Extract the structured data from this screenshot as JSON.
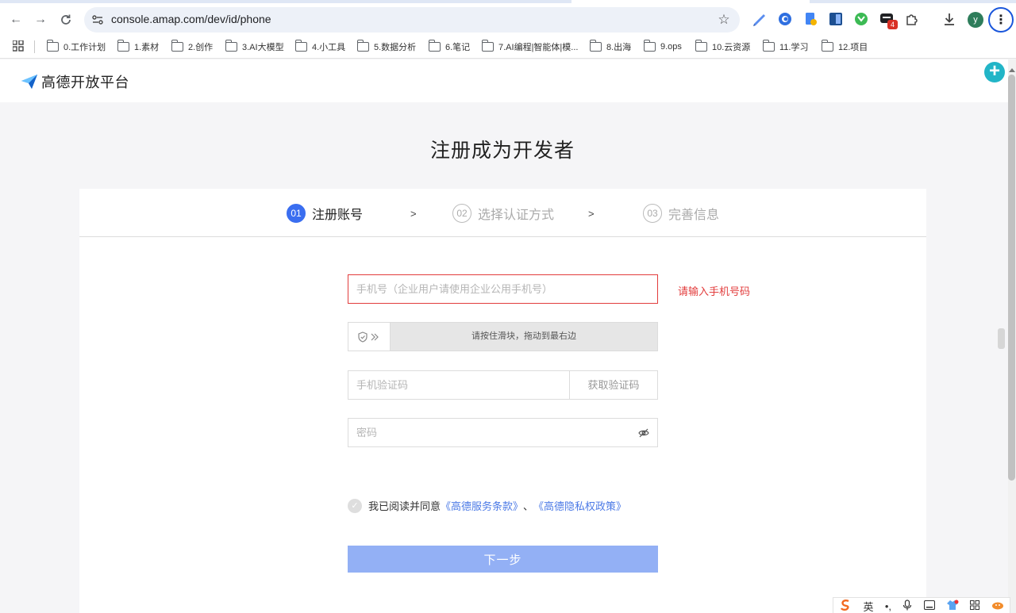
{
  "browser": {
    "url": "console.amap.com/dev/id/phone",
    "extension_badge": "4",
    "avatar_letter": "y",
    "bookmarks": [
      "0.工作计划",
      "1.素材",
      "2.创作",
      "3.AI大模型",
      "4.小工具",
      "5.数据分析",
      "6.笔记",
      "7.AI编程|智能体|模...",
      "8.出海",
      "9.ops",
      "10.云资源",
      "11.学习",
      "12.项目"
    ]
  },
  "site": {
    "logo_text": "高德开放平台"
  },
  "page": {
    "title": "注册成为开发者",
    "steps": [
      {
        "num": "01",
        "label": "注册账号"
      },
      {
        "num": "02",
        "label": "选择认证方式"
      },
      {
        "num": "03",
        "label": "完善信息"
      }
    ],
    "step_separator": ">",
    "form": {
      "phone_placeholder": "手机号（企业用户请使用企业公用手机号）",
      "phone_error": "请输入手机号码",
      "slider_text": "请按住滑块，拖动到最右边",
      "code_placeholder": "手机验证码",
      "get_code_label": "获取验证码",
      "password_placeholder": "密码",
      "agree_prefix": "我已阅读并同意",
      "terms_link": "《高德服务条款》",
      "agree_sep": "、",
      "privacy_link": "《高德隐私权政策》",
      "next_label": "下一步"
    }
  },
  "ime": {
    "lang": "英",
    "punct": "•,"
  },
  "colors": {
    "accent": "#3a6ef0",
    "error": "#e23c3c",
    "link": "#4c7ae6",
    "button_disabled": "#93b0f5"
  }
}
